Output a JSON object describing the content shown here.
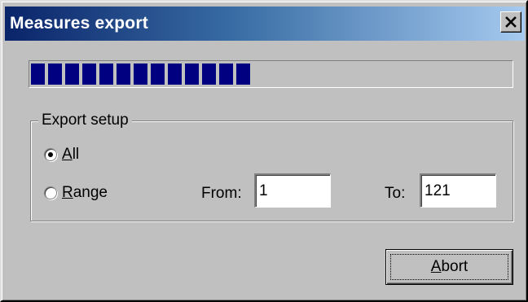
{
  "window": {
    "title": "Measures export",
    "close_icon": "close-icon"
  },
  "progress": {
    "fraction": 0.48,
    "bar_color": "#000080"
  },
  "export_setup": {
    "group_label": "Export setup",
    "options": [
      {
        "id": "all",
        "label": "All",
        "accel": "A",
        "rest": "ll",
        "selected": true
      },
      {
        "id": "range",
        "label": "Range",
        "accel": "R",
        "rest": "ange",
        "selected": false
      }
    ],
    "from_label": "From:",
    "from_value": "1",
    "to_label": "To:",
    "to_value": "121"
  },
  "buttons": {
    "abort_label": "Abort",
    "abort_accel": "A",
    "abort_rest": "bort"
  },
  "colors": {
    "face": "#c0c0c0",
    "titlebar_start": "#0a246a",
    "titlebar_end": "#a6caf0"
  }
}
